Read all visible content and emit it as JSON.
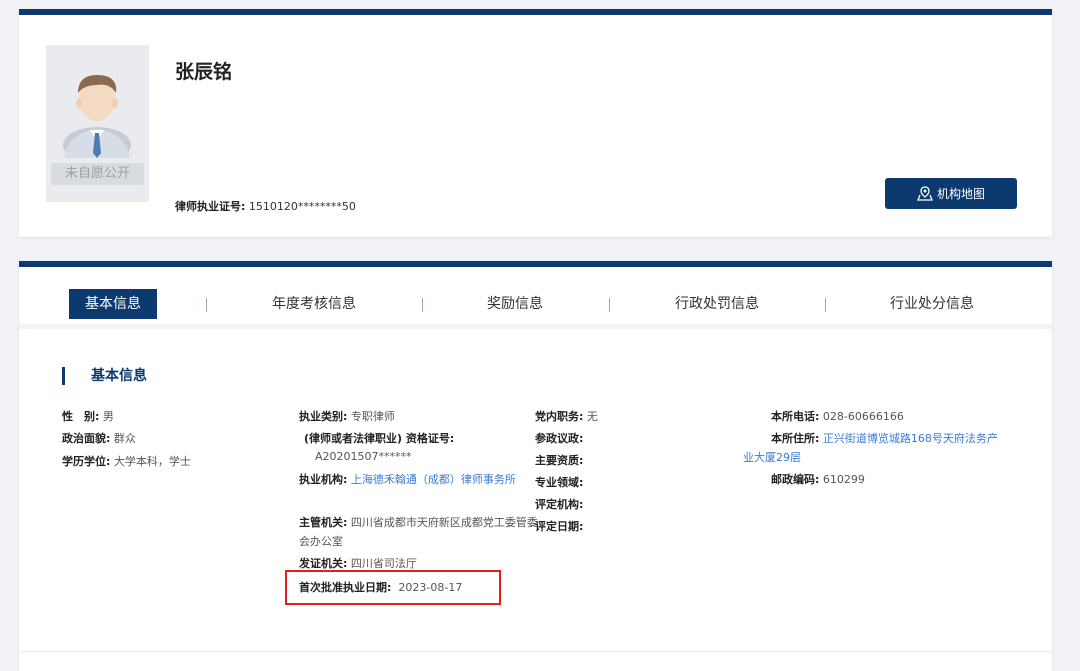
{
  "profile": {
    "name": "张辰铭",
    "avatar_badge": "未自愿公开",
    "license_label": "律师执业证号:",
    "license_value": "1510120********50",
    "map_button": "机构地图"
  },
  "tabs": [
    "基本信息",
    "年度考核信息",
    "奖励信息",
    "行政处罚信息",
    "行业处分信息"
  ],
  "section_title": "基本信息",
  "info": {
    "col1": {
      "gender_label": "性　别:",
      "gender_value": "男",
      "politics_label": "政治面貌:",
      "politics_value": "群众",
      "education_label": "学历学位:",
      "education_value": "大学本科，学士"
    },
    "col2": {
      "type_label": "执业类别:",
      "type_value": "专职律师",
      "qual_label": "(律师或者法律职业) 资格证号:",
      "qual_value": "A20201507******",
      "org_label": "执业机构:",
      "org_value": "上海德禾翰通（成都）律师事务所",
      "authority_label": "主管机关:",
      "authority_value": "四川省成都市天府新区成都党工委管委会办公室",
      "issuer_label": "发证机关:",
      "issuer_value": "四川省司法厅",
      "first_date_label": "首次批准执业日期:",
      "first_date_value": "2023-08-17"
    },
    "col3": {
      "party_label": "党内职务:",
      "party_value": "无",
      "council_label": "参政议政:",
      "council_value": "",
      "qualification_label": "主要资质:",
      "qualification_value": "",
      "field_label": "专业领域:",
      "field_value": "",
      "eval_org_label": "评定机构:",
      "eval_org_value": "",
      "eval_date_label": "评定日期:",
      "eval_date_value": ""
    },
    "col4": {
      "phone_label": "本所电话:",
      "phone_value": "028-60666166",
      "address_label": "本所住所:",
      "address_value": "正兴街道博览城路168号天府法务产业大厦29层",
      "postcode_label": "邮政编码:",
      "postcode_value": "610299"
    }
  },
  "colors": {
    "primary": "#0d3a6e",
    "link": "#3a7bd5",
    "highlight": "#e02020"
  }
}
